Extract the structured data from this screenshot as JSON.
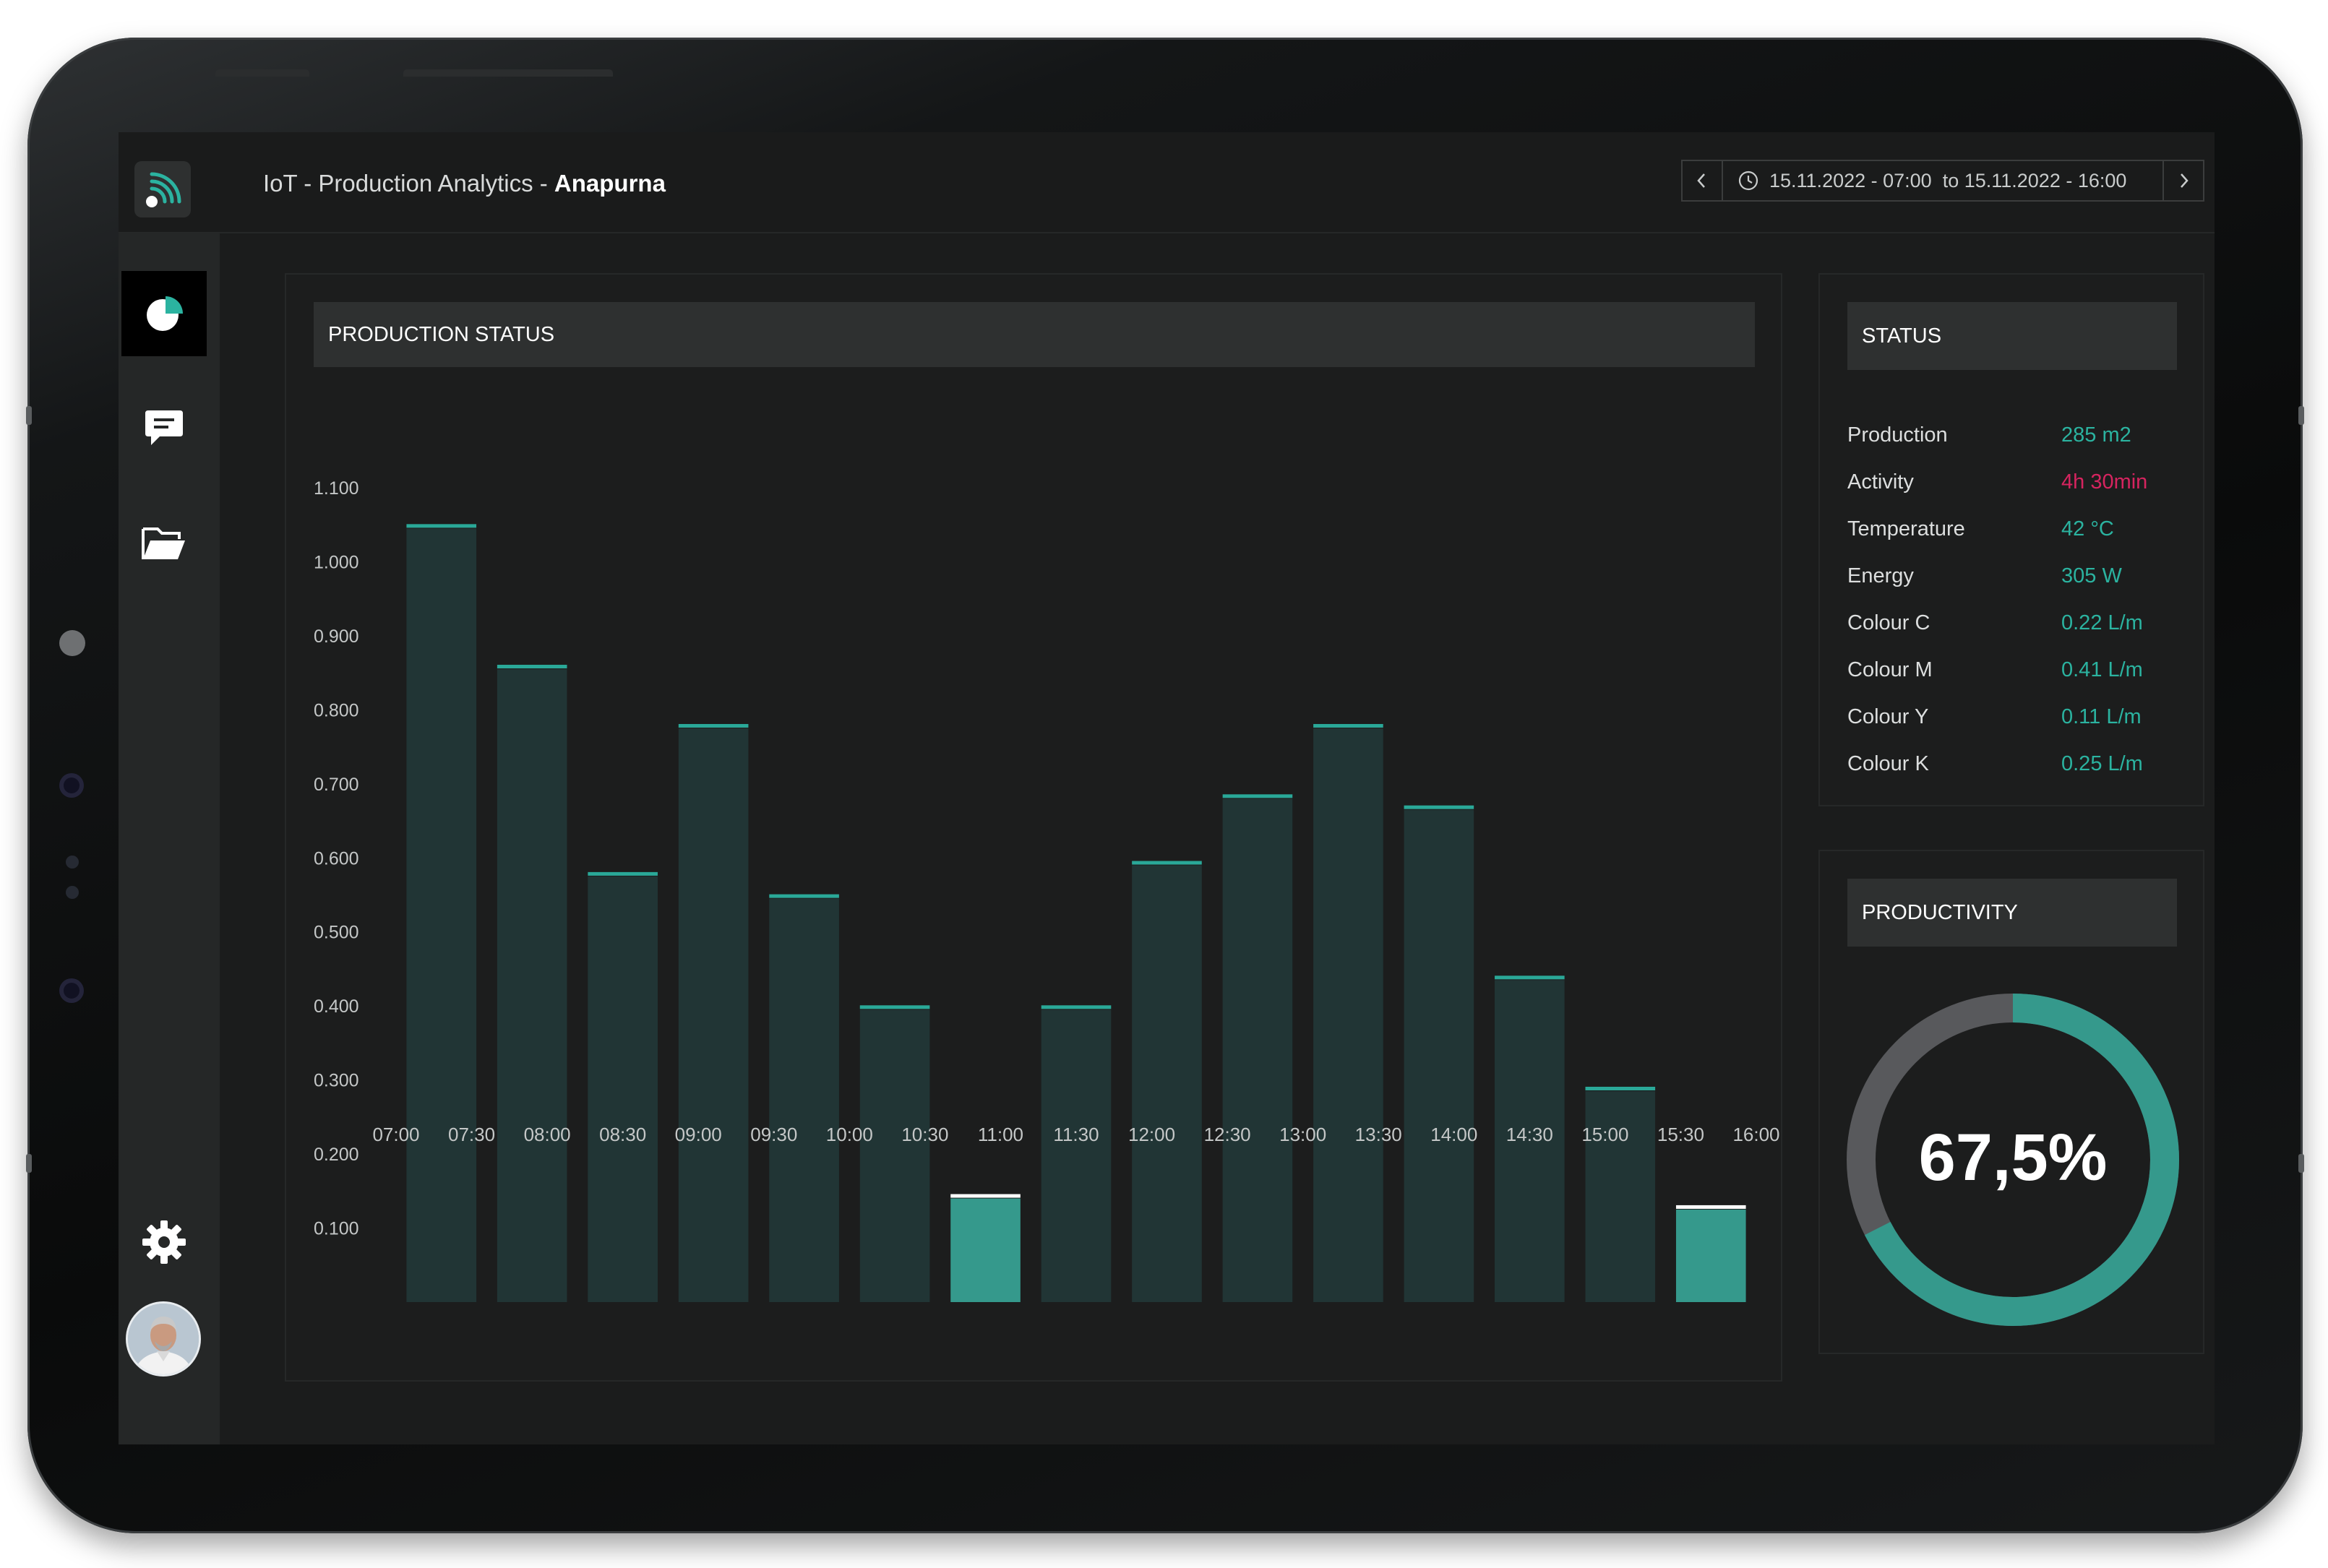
{
  "app": {
    "title_prefix": "IoT - Production Analytics - ",
    "title_bold": "Anapurna"
  },
  "date_range": {
    "label": "15.11.2022 - 07:00  to 15.11.2022 - 16:00"
  },
  "sidebar": {
    "items": [
      {
        "name": "dashboard",
        "icon": "pie-chart-icon",
        "active": true
      },
      {
        "name": "messages",
        "icon": "chat-icon",
        "active": false
      },
      {
        "name": "files",
        "icon": "folder-open-icon",
        "active": false
      }
    ],
    "bottom": [
      {
        "name": "settings",
        "icon": "gear-icon"
      },
      {
        "name": "profile",
        "icon": "avatar"
      }
    ]
  },
  "production_panel": {
    "title": "PRODUCTION STATUS"
  },
  "status_panel": {
    "title": "STATUS",
    "rows": [
      {
        "label": "Production",
        "value": "285 m2",
        "alert": false
      },
      {
        "label": "Activity",
        "value": "4h 30min",
        "alert": true
      },
      {
        "label": "Temperature",
        "value": "42 °C",
        "alert": false
      },
      {
        "label": "Energy",
        "value": "305 W",
        "alert": false
      },
      {
        "label": "Colour C",
        "value": "0.22 L/m",
        "alert": false
      },
      {
        "label": "Colour M",
        "value": "0.41 L/m",
        "alert": false
      },
      {
        "label": "Colour Y",
        "value": "0.11 L/m",
        "alert": false
      },
      {
        "label": "Colour K",
        "value": "0.25 L/m",
        "alert": false
      }
    ]
  },
  "productivity_panel": {
    "title": "PRODUCTIVITY",
    "value_label": "67,5%",
    "fraction": 0.675
  },
  "colors": {
    "accent": "#2bb3a0",
    "alert": "#d6245f",
    "bar": "#213535",
    "bar_top": "#2aa898",
    "bar_highlight": "#35998c",
    "ring_track": "#58595c",
    "ring_fill": "#35998c"
  },
  "chart_data": {
    "type": "bar",
    "categories": [
      "07:00",
      "07:30",
      "08:00",
      "08:30",
      "09:00",
      "09:30",
      "10:00",
      "10:30",
      "11:00",
      "11:30",
      "12:00",
      "12:30",
      "13:00",
      "13:30",
      "14:00",
      "14:30",
      "15:00"
    ],
    "x_tick_labels": [
      "07:00",
      "07:30",
      "08:00",
      "08:30",
      "09:00",
      "09:30",
      "10:00",
      "10:30",
      "11:00",
      "11:30",
      "12:00",
      "12:30",
      "13:00",
      "13:30",
      "14:00",
      "14:30",
      "15:00",
      "15:30",
      "16:00"
    ],
    "values": [
      1.045,
      0.855,
      0.575,
      0.775,
      0.545,
      0.395,
      0.14,
      0.395,
      0.59,
      0.68,
      0.775,
      0.665,
      0.435,
      0.285,
      0.125
    ],
    "highlighted": [
      false,
      false,
      false,
      false,
      false,
      false,
      true,
      false,
      false,
      false,
      false,
      false,
      false,
      false,
      true
    ],
    "y_ticks": [
      1.1,
      1.0,
      0.9,
      0.8,
      0.7,
      0.6,
      0.5,
      0.4,
      0.3,
      0.2,
      0.1
    ],
    "y_tick_labels": [
      "1.100",
      "1.000",
      "0.900",
      "0.800",
      "0.700",
      "0.600",
      "0.500",
      "0.400",
      "0.300",
      "0.200",
      "0.100"
    ],
    "ylim": [
      0,
      1.1
    ],
    "grid": false,
    "title": "PRODUCTION STATUS",
    "xlabel": "",
    "ylabel": ""
  }
}
